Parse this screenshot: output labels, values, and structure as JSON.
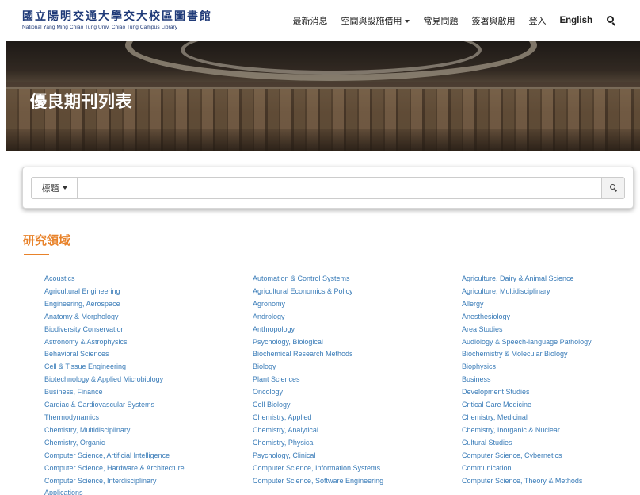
{
  "header": {
    "logo_cn": "國立陽明交通大學交大校區圖書館",
    "logo_en": "National Yang Ming Chiao Tung Univ. Chiao Tung Campus Library",
    "nav": [
      {
        "label": "最新消息"
      },
      {
        "label": "空間與設施借用"
      },
      {
        "label": "常見問題"
      },
      {
        "label": "簽署與啟用"
      },
      {
        "label": "登入"
      },
      {
        "label": "English"
      }
    ]
  },
  "banner": {
    "title": "優良期刊列表"
  },
  "search": {
    "field_label": "標題",
    "input_value": "",
    "placeholder": ""
  },
  "research": {
    "title": "研究領域",
    "columns": [
      [
        "Acoustics",
        "Agricultural Engineering",
        "Engineering, Aerospace",
        "Anatomy & Morphology",
        "Biodiversity Conservation",
        "Astronomy & Astrophysics",
        "Behavioral Sciences",
        "Cell & Tissue Engineering",
        "Biotechnology & Applied Microbiology",
        "Business, Finance",
        "Cardiac & Cardiovascular Systems",
        "Thermodynamics",
        "Chemistry, Multidisciplinary",
        "Chemistry, Organic",
        "Computer Science, Artificial Intelligence",
        "Computer Science, Hardware & Architecture",
        "Computer Science, Interdisciplinary",
        "Applications"
      ],
      [
        "Automation & Control Systems",
        "Agricultural Economics & Policy",
        "Agronomy",
        "Andrology",
        "Anthropology",
        "Psychology, Biological",
        "Biochemical Research Methods",
        "Biology",
        "Plant Sciences",
        "Oncology",
        "Cell Biology",
        "Chemistry, Applied",
        "Chemistry, Analytical",
        "Chemistry, Physical",
        "Psychology, Clinical",
        "Computer Science, Information Systems",
        "Computer Science, Software Engineering"
      ],
      [
        "Agriculture, Dairy & Animal Science",
        "Agriculture, Multidisciplinary",
        "Allergy",
        "Anesthesiology",
        "Area Studies",
        "Audiology & Speech-language Pathology",
        "Biochemistry & Molecular Biology",
        "Biophysics",
        "Business",
        "Development Studies",
        "Critical Care Medicine",
        "Chemistry, Medicinal",
        "Chemistry, Inorganic & Nuclear",
        "Cultural Studies",
        "Computer Science, Cybernetics",
        "Communication",
        "Computer Science, Theory & Methods"
      ]
    ]
  },
  "colors": {
    "accent": "#e8822a",
    "link": "#3a7cb8",
    "logo": "#1f3a78"
  },
  "icons": {
    "nav_search": "search-icon",
    "submit": "search-icon",
    "dropdown": "caret-down-icon"
  }
}
